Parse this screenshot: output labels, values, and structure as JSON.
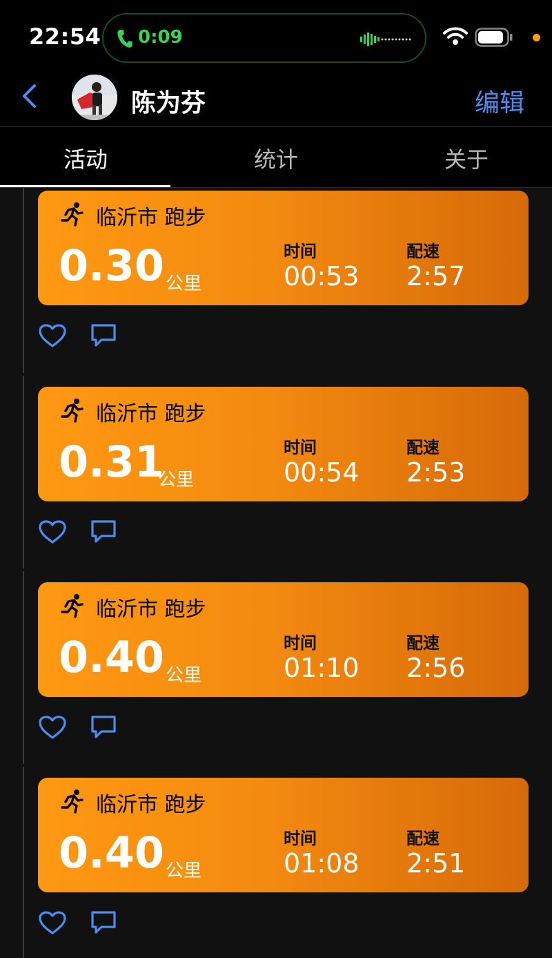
{
  "status_bar": {
    "time": "22:54",
    "call_duration": "0:09",
    "call_color": "#39d353",
    "icons": [
      "phone-icon",
      "audio-wave-icon",
      "wifi-icon",
      "battery-icon",
      "privacy-dot"
    ]
  },
  "nav": {
    "title": "陈为芬",
    "edit_label": "编辑",
    "accent_color": "#4b8ef1",
    "back_icon": "chevron-left-icon",
    "avatar": "avatar"
  },
  "tabs": [
    {
      "label": "活动",
      "active": true
    },
    {
      "label": "统计",
      "active": false
    },
    {
      "label": "关于",
      "active": false
    }
  ],
  "activities": [
    {
      "title": "临沂市 跑步",
      "distance": "0.30",
      "unit": "公里",
      "time_label": "时间",
      "time": "00:53",
      "pace_label": "配速",
      "pace": "2:57"
    },
    {
      "title": "临沂市 跑步",
      "distance": "0.31",
      "unit": "公里",
      "time_label": "时间",
      "time": "00:54",
      "pace_label": "配速",
      "pace": "2:53"
    },
    {
      "title": "临沂市 跑步",
      "distance": "0.40",
      "unit": "公里",
      "time_label": "时间",
      "time": "01:10",
      "pace_label": "配速",
      "pace": "2:56"
    },
    {
      "title": "临沂市 跑步",
      "distance": "0.40",
      "unit": "公里",
      "time_label": "时间",
      "time": "01:08",
      "pace_label": "配速",
      "pace": "2:51"
    }
  ],
  "card_colors": {
    "start": "#ff9811",
    "end": "#d76a08"
  },
  "action_icons": [
    "heart-icon",
    "comment-icon"
  ],
  "action_color": "#4b8ef1"
}
